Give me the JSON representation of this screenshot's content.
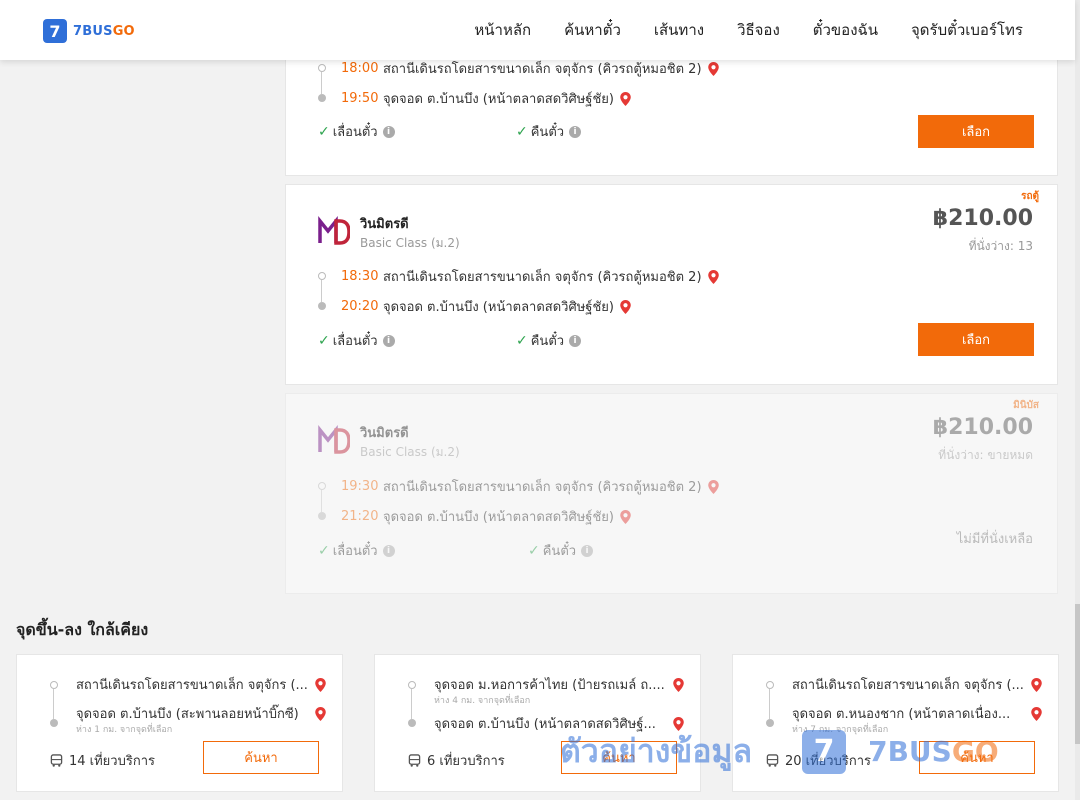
{
  "header": {
    "logo_mark": "7",
    "logo_text_a": "7BUS",
    "logo_text_b": "GO",
    "nav": [
      "หน้าหลัก",
      "ค้นหาตั๋ว",
      "เส้นทาง",
      "วิธีจอง",
      "ตั๋วของฉัน",
      "จุดรับตั๋วเบอร์โทร"
    ]
  },
  "trips": [
    {
      "depart_time": "18:00",
      "depart_place": "สถานีเดินรถโดยสารขนาดเล็ก จตุจักร (คิวรถตู้หมอชิต 2)",
      "arrive_time": "19:50",
      "arrive_place": "จุดจอด ต.บ้านบึง (หน้าตลาดสดวิศิษฐ์ชัย)",
      "feature_1": "เลื่อนตั๋ว",
      "feature_2": "คืนตั๋ว",
      "button": "เลือก"
    },
    {
      "bus_type": "รถตู้",
      "operator": "วินมิตรดี",
      "class": "Basic Class (ม.2)",
      "price": "฿210.00",
      "seats": "ที่นั่งว่าง: 13",
      "depart_time": "18:30",
      "depart_place": "สถานีเดินรถโดยสารขนาดเล็ก จตุจักร (คิวรถตู้หมอชิต 2)",
      "arrive_time": "20:20",
      "arrive_place": "จุดจอด ต.บ้านบึง (หน้าตลาดสดวิศิษฐ์ชัย)",
      "feature_1": "เลื่อนตั๋ว",
      "feature_2": "คืนตั๋ว",
      "button": "เลือก"
    },
    {
      "bus_type": "มินิบัส",
      "operator": "วินมิตรดี",
      "class": "Basic Class (ม.2)",
      "price": "฿210.00",
      "seats": "ที่นั่งว่าง: ขายหมด",
      "depart_time": "19:30",
      "depart_place": "สถานีเดินรถโดยสารขนาดเล็ก จตุจักร (คิวรถตู้หมอชิต 2)",
      "arrive_time": "21:20",
      "arrive_place": "จุดจอด ต.บ้านบึง (หน้าตลาดสดวิศิษฐ์ชัย)",
      "feature_1": "เลื่อนตั๋ว",
      "feature_2": "คืนตั๋ว",
      "status": "ไม่มีที่นั่งเหลือ"
    }
  ],
  "nearby": {
    "title": "จุดขึ้น-ลง ใกล้เคียง",
    "cards": [
      {
        "from": "สถานีเดินรถโดยสารขนาดเล็ก จตุจักร (...",
        "to": "จุดจอด ต.บ้านบึง (สะพานลอยหน้าบิ๊กซี)",
        "to_distance": "ห่าง 1 กม. จากจุดที่เลือก",
        "trips": "14 เที่ยวบริการ",
        "button": "ค้นหา"
      },
      {
        "from": "จุดจอด ม.หอการค้าไทย (ป้ายรถเมล์ ถ....",
        "from_distance": "ห่าง 4 กม. จากจุดที่เลือก",
        "to": "จุดจอด ต.บ้านบึง (หน้าตลาดสดวิศิษฐ์...",
        "trips": "6 เที่ยวบริการ",
        "button": "ค้นหา"
      },
      {
        "from": "สถานีเดินรถโดยสารขนาดเล็ก จตุจักร (...",
        "to": "จุดจอด ต.หนองชาก (หน้าตลาดเนื่อง...",
        "to_distance": "ห่าง 7 กม. จากจุดที่เลือก",
        "trips": "20 เที่ยวบริการ",
        "button": "ค้นหา"
      }
    ]
  },
  "watermark": {
    "text": "ตัวอย่างข้อมูล",
    "mark": "7",
    "logo_a": "7BUS",
    "logo_b": "GO"
  },
  "colors": {
    "accent": "#f26a0a",
    "brand": "#2f6fd8",
    "check": "#2ea44f",
    "pin": "#e53935"
  },
  "icons": [
    "location-pin-icon",
    "check-icon",
    "info-icon",
    "bus-icon",
    "operator-logo"
  ]
}
